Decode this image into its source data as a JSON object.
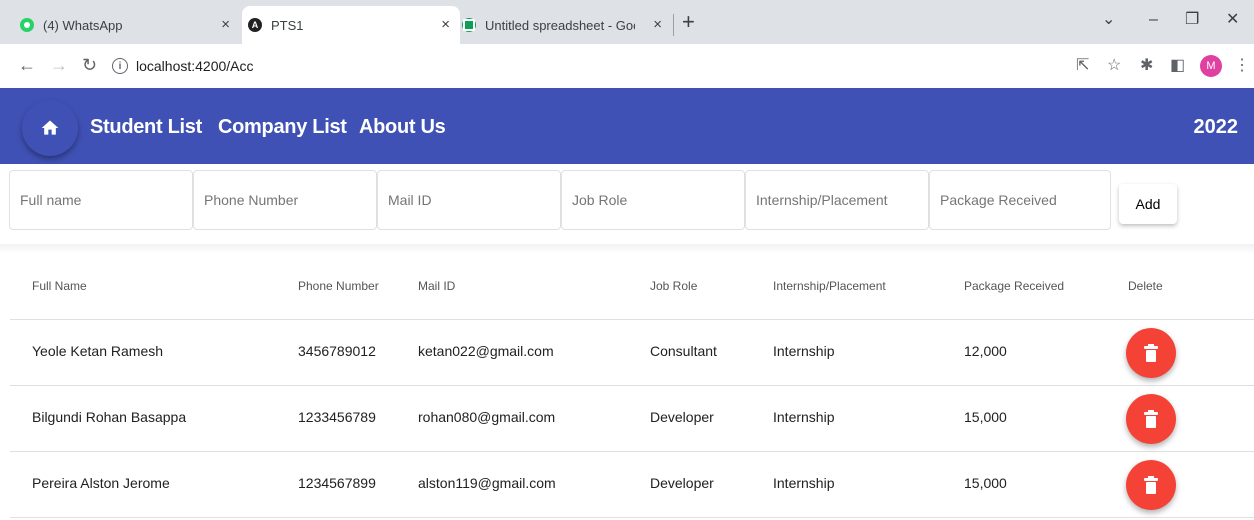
{
  "browser": {
    "tabs": [
      {
        "title": "(4) WhatsApp",
        "favicon": "whatsapp-icon",
        "active": false
      },
      {
        "title": "PTS1",
        "favicon": "angular-icon",
        "active": true
      },
      {
        "title": "Untitled spreadsheet - Google Sh",
        "favicon": "google-sheets-icon",
        "active": false
      }
    ],
    "new_tab": "+",
    "url": "localhost:4200/Acc",
    "profile_initial": "M",
    "colors": {
      "tabstrip": "#dee1e6",
      "avatar": "#e040a0"
    }
  },
  "toolbar": {
    "home_icon": "home-icon",
    "nav": [
      "Student List",
      "Company List",
      "About Us"
    ],
    "year": "2022",
    "color": "#3f51b5"
  },
  "form": {
    "placeholders": [
      "Full name",
      "Phone Number",
      "Mail ID",
      "Job Role",
      "Internship/Placement",
      "Package Received"
    ],
    "add_label": "Add"
  },
  "table": {
    "headers": [
      "Full Name",
      "Phone Number",
      "Mail ID",
      "Job Role",
      "Internship/Placement",
      "Package Received",
      "Delete"
    ],
    "rows": [
      {
        "name": "Yeole Ketan Ramesh",
        "phone": "3456789012",
        "mail": "ketan022@gmail.com",
        "role": "Consultant",
        "type": "Internship",
        "package": "12,000"
      },
      {
        "name": "Bilgundi Rohan Basappa",
        "phone": "1233456789",
        "mail": "rohan080@gmail.com",
        "role": "Developer",
        "type": "Internship",
        "package": "15,000"
      },
      {
        "name": "Pereira Alston Jerome",
        "phone": "1234567899",
        "mail": "alston119@gmail.com",
        "role": "Developer",
        "type": "Internship",
        "package": "15,000"
      }
    ],
    "delete_icon": "trash-icon",
    "delete_color": "#f44336"
  }
}
